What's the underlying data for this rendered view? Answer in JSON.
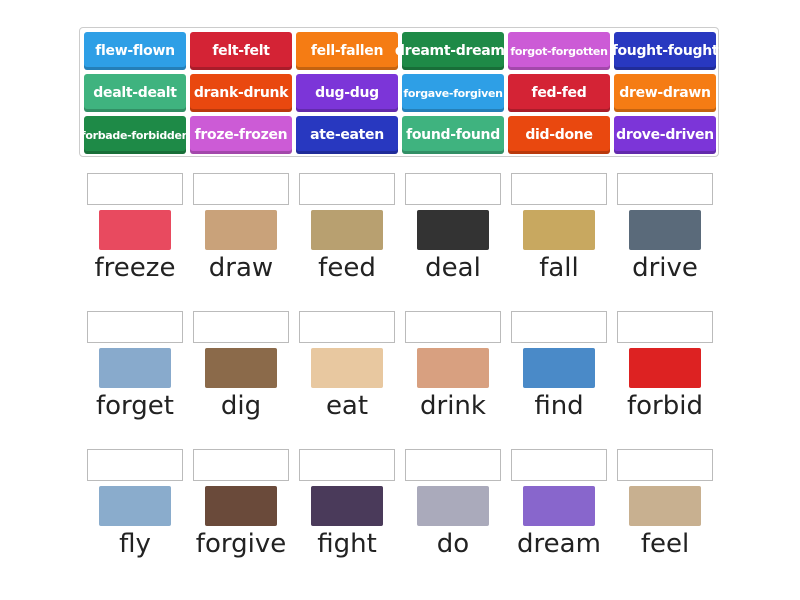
{
  "tiles": [
    {
      "label": "flew-flown",
      "color": "#2e9fe6"
    },
    {
      "label": "felt-felt",
      "color": "#d42335"
    },
    {
      "label": "fell-fallen",
      "color": "#f57c14"
    },
    {
      "label": "dreamt-dreamt",
      "color": "#1e8a47"
    },
    {
      "label": "forgot-forgotten",
      "color": "#cc5bd6"
    },
    {
      "label": "fought-fought",
      "color": "#2838c0"
    },
    {
      "label": "dealt-dealt",
      "color": "#3fb37f"
    },
    {
      "label": "drank-drunk",
      "color": "#e9480f"
    },
    {
      "label": "dug-dug",
      "color": "#7c35d8"
    },
    {
      "label": "forgave-forgiven",
      "color": "#2e9fe6"
    },
    {
      "label": "fed-fed",
      "color": "#d42335"
    },
    {
      "label": "drew-drawn",
      "color": "#f57c14"
    },
    {
      "label": "forbade-forbidden",
      "color": "#1e8a47"
    },
    {
      "label": "froze-frozen",
      "color": "#cc5bd6"
    },
    {
      "label": "ate-eaten",
      "color": "#2838c0"
    },
    {
      "label": "found-found",
      "color": "#3fb37f"
    },
    {
      "label": "did-done",
      "color": "#e9480f"
    },
    {
      "label": "drove-driven",
      "color": "#7c35d8"
    }
  ],
  "words": [
    {
      "label": "freeze",
      "image": "slush-drinks-image"
    },
    {
      "label": "draw",
      "image": "drawing-dog-image"
    },
    {
      "label": "feed",
      "image": "feeding-chickens-image"
    },
    {
      "label": "deal",
      "image": "handshake-image"
    },
    {
      "label": "fall",
      "image": "falling-stairs-image"
    },
    {
      "label": "drive",
      "image": "driving-car-image"
    },
    {
      "label": "forget",
      "image": "forgetful-person-image"
    },
    {
      "label": "dig",
      "image": "digging-man-image"
    },
    {
      "label": "eat",
      "image": "baby-eating-image"
    },
    {
      "label": "drink",
      "image": "children-drinking-image"
    },
    {
      "label": "find",
      "image": "www-search-image"
    },
    {
      "label": "forbid",
      "image": "no-entry-sign-image"
    },
    {
      "label": "fly",
      "image": "airplane-image"
    },
    {
      "label": "forgive",
      "image": "hug-image"
    },
    {
      "label": "fight",
      "image": "fighting-game-image"
    },
    {
      "label": "do",
      "image": "homework-image"
    },
    {
      "label": "dream",
      "image": "dream-cartoon-image"
    },
    {
      "label": "feel",
      "image": "beach-happy-image"
    }
  ]
}
